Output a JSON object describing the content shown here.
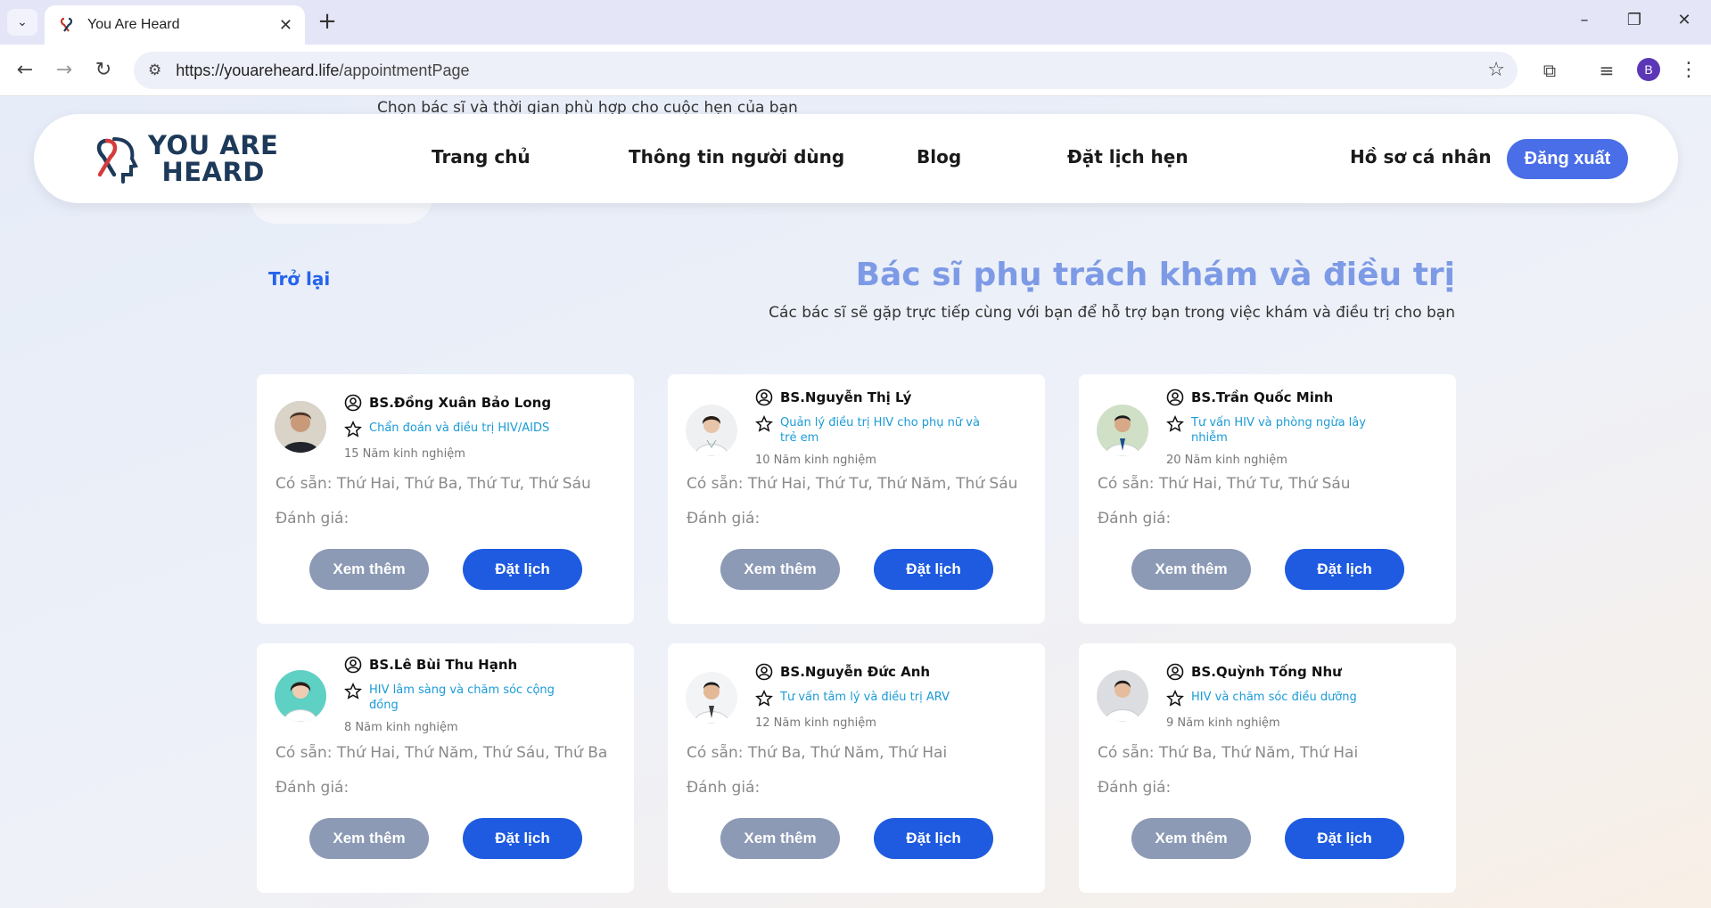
{
  "browser": {
    "tab_title": "You Are Heard",
    "url_host": "https://youareheard.life",
    "url_path": "/appointmentPage",
    "profile_initial": "B"
  },
  "behind_text": "Chọn bác sĩ và thời gian phù hợp cho cuộc hẹn của bạn",
  "header": {
    "logo_line1": "YOU ARE",
    "logo_line2": "HEARD",
    "nav": [
      "Trang chủ",
      "Thông tin người dùng",
      "Blog",
      "Đặt lịch hẹn",
      "Hồ sơ cá nhân"
    ],
    "logout": "Đăng xuất"
  },
  "back_label": "Trở lại",
  "section": {
    "title": "Bác sĩ phụ trách khám và điều trị",
    "subtitle": "Các bác sĩ sẽ gặp trực tiếp cùng với bạn để hỗ trợ bạn trong việc khám và điều trị cho bạn"
  },
  "doctors": [
    {
      "name": "BS.Đồng Xuân Bảo Long",
      "specialty": "Chẩn đoán và điều trị HIV/AIDS",
      "experience": "15 Năm kinh nghiệm",
      "availability": "Có sẵn: Thứ Hai, Thứ Ba, Thứ Tư, Thứ Sáu",
      "rating": "Đánh giá:",
      "more": "Xem thêm",
      "book": "Đặt lịch"
    },
    {
      "name": "BS.Nguyễn Thị Lý",
      "specialty": "Quản lý điều trị HIV cho phụ nữ và trẻ em",
      "experience": "10 Năm kinh nghiệm",
      "availability": "Có sẵn: Thứ Hai, Thứ Tư, Thứ Năm, Thứ Sáu",
      "rating": "Đánh giá:",
      "more": "Xem thêm",
      "book": "Đặt lịch"
    },
    {
      "name": "BS.Trần Quốc Minh",
      "specialty": "Tư vấn HIV và phòng ngừa lây nhiễm",
      "experience": "20 Năm kinh nghiệm",
      "availability": "Có sẵn: Thứ Hai, Thứ Tư, Thứ Sáu",
      "rating": "Đánh giá:",
      "more": "Xem thêm",
      "book": "Đặt lịch"
    },
    {
      "name": "BS.Lê Bùi Thu Hạnh",
      "specialty": "HIV lâm sàng và chăm sóc cộng đồng",
      "experience": "8 Năm kinh nghiệm",
      "availability": "Có sẵn: Thứ Hai, Thứ Năm, Thứ Sáu, Thứ Ba",
      "rating": "Đánh giá:",
      "more": "Xem thêm",
      "book": "Đặt lịch"
    },
    {
      "name": "BS.Nguyễn Đức Anh",
      "specialty": "Tư vấn tâm lý và điều trị ARV",
      "experience": "12 Năm kinh nghiệm",
      "availability": "Có sẵn: Thứ Ba, Thứ Năm, Thứ Hai",
      "rating": "Đánh giá:",
      "more": "Xem thêm",
      "book": "Đặt lịch"
    },
    {
      "name": "BS.Quỳnh Tống Như",
      "specialty": "HIV và chăm sóc điều dưỡng",
      "experience": "9 Năm kinh nghiệm",
      "availability": "Có sẵn: Thứ Ba, Thứ Năm, Thứ Hai",
      "rating": "Đánh giá:",
      "more": "Xem thêm",
      "book": "Đặt lịch"
    }
  ]
}
